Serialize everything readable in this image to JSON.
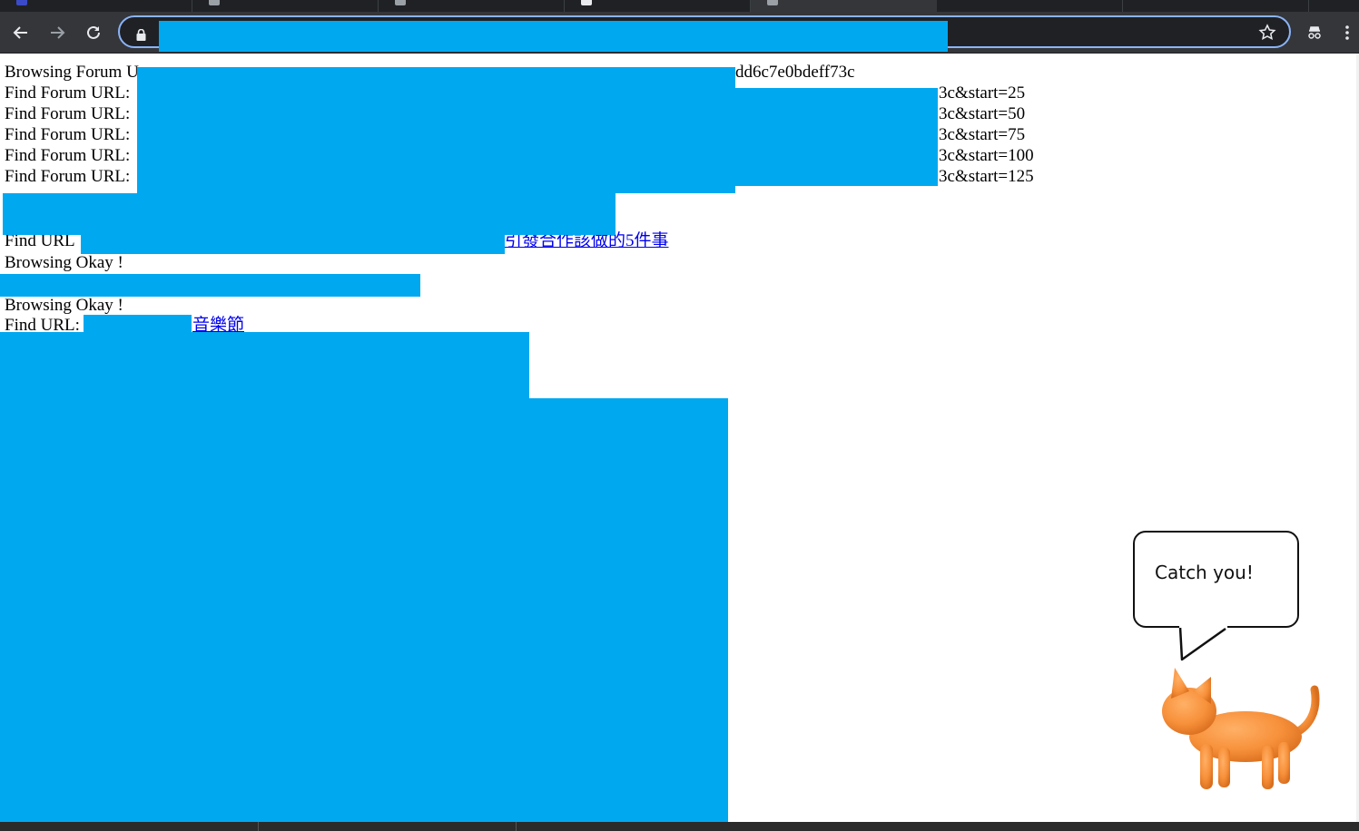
{
  "browser": {
    "tabs": [
      {
        "favicon_color": "#3b4bc8"
      },
      {
        "favicon_color": "#9aa0a6"
      },
      {
        "favicon_color": "#9aa0a6"
      },
      {
        "favicon_color": "#9aa0a6"
      },
      {
        "favicon_color": "#e8eaed"
      },
      {
        "favicon_color": "#9aa0a6"
      },
      {
        "favicon_color": "#9aa0a6"
      }
    ],
    "url": "",
    "icons": {
      "back": "arrow-left-icon",
      "forward": "arrow-right-icon",
      "reload": "reload-icon",
      "lock": "lock-icon",
      "bookmark": "star-icon",
      "incognito": "incognito-icon",
      "menu": "kebab-menu-icon"
    }
  },
  "page": {
    "lines": [
      {
        "prefix": "Browsing Forum U",
        "tail": "dd6c7e0bdeff73c"
      },
      {
        "prefix": "Find Forum URL:",
        "tail": "3c&start=25"
      },
      {
        "prefix": "Find Forum URL:",
        "tail": "3c&start=50"
      },
      {
        "prefix": "Find Forum URL:",
        "tail": "3c&start=75"
      },
      {
        "prefix": "Find Forum URL:",
        "tail": "3c&start=100"
      },
      {
        "prefix": "Find Forum URL:",
        "tail": "3c&start=125"
      }
    ],
    "find_url_1": {
      "prefix": "Find URL",
      "link": "引發合作該做的5件事"
    },
    "browsing_okay_1": "Browsing Okay !",
    "browsing_okay_2": "Browsing Okay !",
    "find_url_2": {
      "prefix": "Find URL:",
      "link": "音樂節"
    },
    "redaction_color": "#00a8f0"
  },
  "overlay": {
    "bubble_text": "Catch you!",
    "cat_color": "#f7903a"
  }
}
